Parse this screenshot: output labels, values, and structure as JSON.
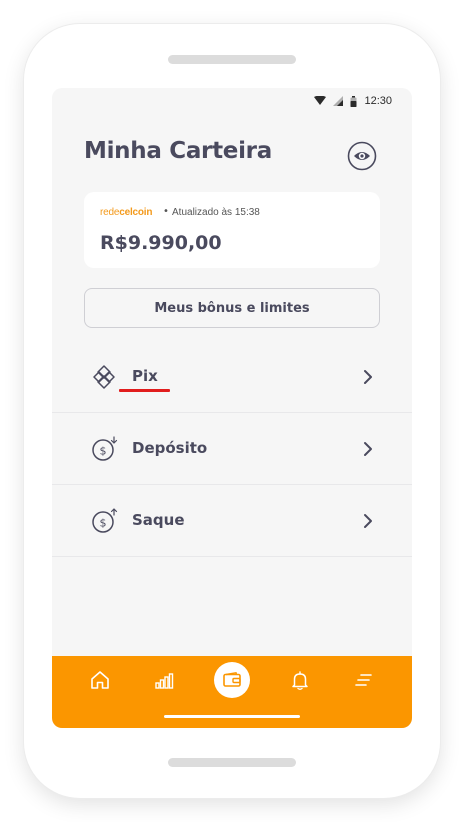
{
  "status_bar": {
    "time": "12:30"
  },
  "header": {
    "title": "Minha Carteira",
    "visibility_icon": "eye-icon"
  },
  "balance_card": {
    "brand_part1": "rede",
    "brand_part2": "celcoin",
    "separator": "•",
    "updated_text": "Atualizado às 15:38",
    "amount": "R$9.990,00"
  },
  "bonus_button": {
    "label": "Meus bônus e limites"
  },
  "menu": [
    {
      "label": "Pix",
      "icon": "pix-icon"
    },
    {
      "label": "Depósito",
      "icon": "deposit-icon"
    },
    {
      "label": "Saque",
      "icon": "withdraw-icon"
    }
  ],
  "bottom_nav": {
    "items": [
      "home-icon",
      "chart-icon",
      "wallet-icon",
      "bell-icon",
      "menu-icon"
    ],
    "active": "wallet-icon"
  },
  "colors": {
    "accent": "#fb9600",
    "text_primary": "#4a4a5e",
    "screen_bg": "#f6f6f6",
    "annotation_underline": "#e11d1d",
    "brand": "#f39a1c"
  }
}
